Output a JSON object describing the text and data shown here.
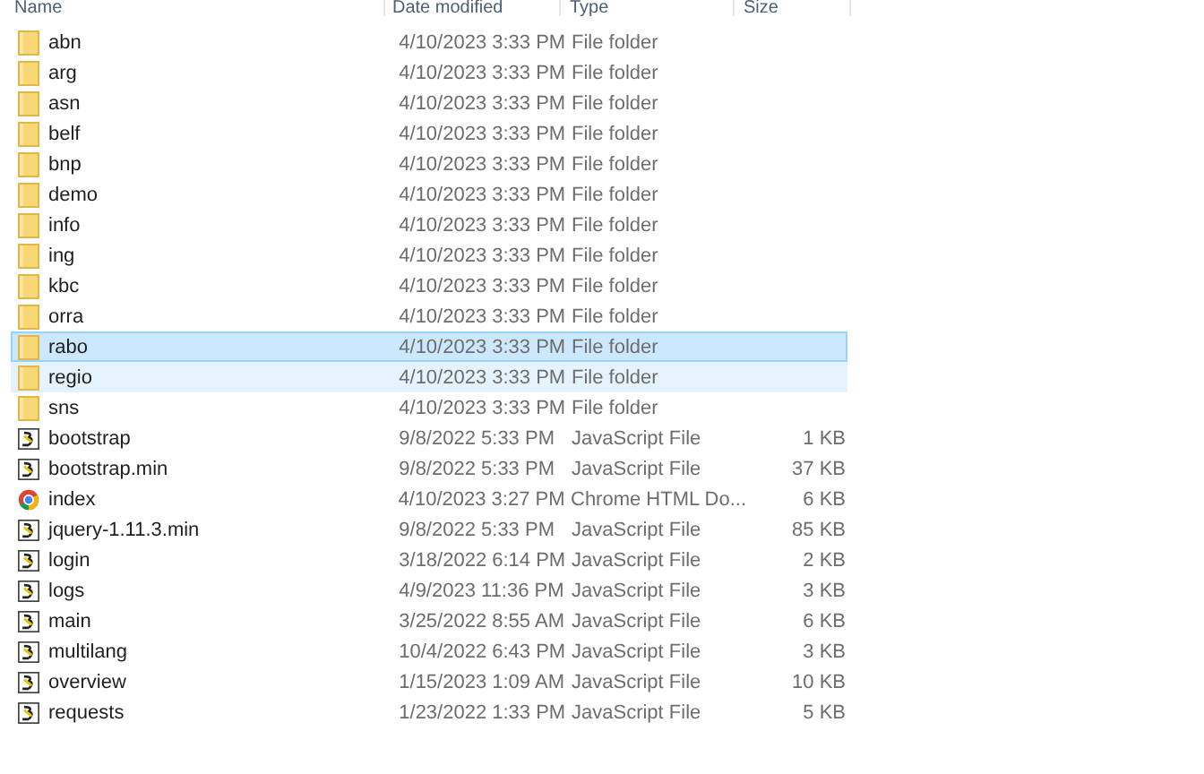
{
  "columns": [
    "Name",
    "Date modified",
    "Type",
    "Size"
  ],
  "rows": [
    {
      "kind": "folder",
      "name": "abn",
      "date": "4/10/2023 3:33 PM",
      "type": "File folder",
      "size": "",
      "selected": false,
      "hovered": false
    },
    {
      "kind": "folder",
      "name": "arg",
      "date": "4/10/2023 3:33 PM",
      "type": "File folder",
      "size": "",
      "selected": false,
      "hovered": false
    },
    {
      "kind": "folder",
      "name": "asn",
      "date": "4/10/2023 3:33 PM",
      "type": "File folder",
      "size": "",
      "selected": false,
      "hovered": false
    },
    {
      "kind": "folder",
      "name": "belf",
      "date": "4/10/2023 3:33 PM",
      "type": "File folder",
      "size": "",
      "selected": false,
      "hovered": false
    },
    {
      "kind": "folder",
      "name": "bnp",
      "date": "4/10/2023 3:33 PM",
      "type": "File folder",
      "size": "",
      "selected": false,
      "hovered": false
    },
    {
      "kind": "folder",
      "name": "demo",
      "date": "4/10/2023 3:33 PM",
      "type": "File folder",
      "size": "",
      "selected": false,
      "hovered": false
    },
    {
      "kind": "folder",
      "name": "info",
      "date": "4/10/2023 3:33 PM",
      "type": "File folder",
      "size": "",
      "selected": false,
      "hovered": false
    },
    {
      "kind": "folder",
      "name": "ing",
      "date": "4/10/2023 3:33 PM",
      "type": "File folder",
      "size": "",
      "selected": false,
      "hovered": false
    },
    {
      "kind": "folder",
      "name": "kbc",
      "date": "4/10/2023 3:33 PM",
      "type": "File folder",
      "size": "",
      "selected": false,
      "hovered": false
    },
    {
      "kind": "folder",
      "name": "orra",
      "date": "4/10/2023 3:33 PM",
      "type": "File folder",
      "size": "",
      "selected": false,
      "hovered": false
    },
    {
      "kind": "folder",
      "name": "rabo",
      "date": "4/10/2023 3:33 PM",
      "type": "File folder",
      "size": "",
      "selected": true,
      "hovered": false
    },
    {
      "kind": "folder",
      "name": "regio",
      "date": "4/10/2023 3:33 PM",
      "type": "File folder",
      "size": "",
      "selected": false,
      "hovered": true
    },
    {
      "kind": "folder",
      "name": "sns",
      "date": "4/10/2023 3:33 PM",
      "type": "File folder",
      "size": "",
      "selected": false,
      "hovered": false
    },
    {
      "kind": "script",
      "name": "bootstrap",
      "date": "9/8/2022 5:33 PM",
      "type": "JavaScript File",
      "size": "1 KB",
      "selected": false,
      "hovered": false
    },
    {
      "kind": "script",
      "name": "bootstrap.min",
      "date": "9/8/2022 5:33 PM",
      "type": "JavaScript File",
      "size": "37 KB",
      "selected": false,
      "hovered": false
    },
    {
      "kind": "html",
      "name": "index",
      "date": "4/10/2023 3:27 PM",
      "type": "Chrome HTML Do...",
      "size": "6 KB",
      "selected": false,
      "hovered": false
    },
    {
      "kind": "script",
      "name": "jquery-1.11.3.min",
      "date": "9/8/2022 5:33 PM",
      "type": "JavaScript File",
      "size": "85 KB",
      "selected": false,
      "hovered": false
    },
    {
      "kind": "script",
      "name": "login",
      "date": "3/18/2022 6:14 PM",
      "type": "JavaScript File",
      "size": "2 KB",
      "selected": false,
      "hovered": false
    },
    {
      "kind": "script",
      "name": "logs",
      "date": "4/9/2023 11:36 PM",
      "type": "JavaScript File",
      "size": "3 KB",
      "selected": false,
      "hovered": false
    },
    {
      "kind": "script",
      "name": "main",
      "date": "3/25/2022 8:55 AM",
      "type": "JavaScript File",
      "size": "6 KB",
      "selected": false,
      "hovered": false
    },
    {
      "kind": "script",
      "name": "multilang",
      "date": "10/4/2022 6:43 PM",
      "type": "JavaScript File",
      "size": "3 KB",
      "selected": false,
      "hovered": false
    },
    {
      "kind": "script",
      "name": "overview",
      "date": "1/15/2023 1:09 AM",
      "type": "JavaScript File",
      "size": "10 KB",
      "selected": false,
      "hovered": false
    },
    {
      "kind": "script",
      "name": "requests",
      "date": "1/23/2022 1:33 PM",
      "type": "JavaScript File",
      "size": "5 KB",
      "selected": false,
      "hovered": false
    }
  ]
}
